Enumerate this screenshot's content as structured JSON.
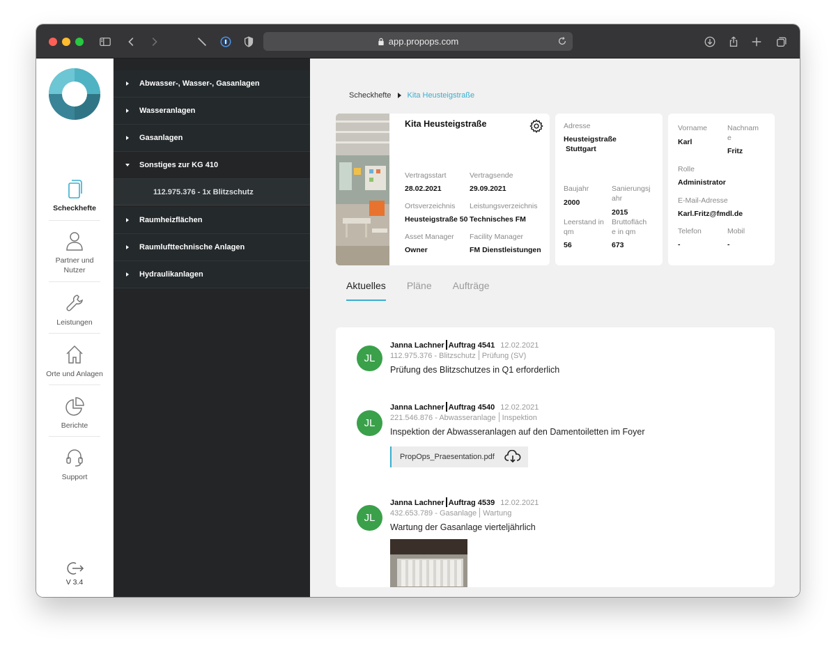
{
  "browser": {
    "url": "app.propops.com",
    "traffic_colors": [
      "#fe5f57",
      "#febc2e",
      "#28c840"
    ]
  },
  "sidebar": {
    "items": [
      {
        "label": "Scheckhefte",
        "icon": "copy-icon"
      },
      {
        "label": "Partner und Nutzer",
        "icon": "user-icon"
      },
      {
        "label": "Leistungen",
        "icon": "wrench-icon"
      },
      {
        "label": "Orte und Anlagen",
        "icon": "home-icon"
      },
      {
        "label": "Berichte",
        "icon": "pie-chart-icon"
      },
      {
        "label": "Support",
        "icon": "headset-icon"
      }
    ],
    "version": "V 3.4"
  },
  "tree": {
    "items": [
      {
        "label": "Abwasser-, Wasser-, Gasanlagen"
      },
      {
        "label": "Wasseranlagen"
      },
      {
        "label": "Gasanlagen"
      },
      {
        "label": "Sonstiges zur KG 410"
      },
      {
        "label": "Raumheizflächen"
      },
      {
        "label": "Raumlufttechnische Anlagen"
      },
      {
        "label": "Hydraulikanlagen"
      }
    ],
    "sub_item": "112.975.376 - 1x Blitzschutz"
  },
  "breadcrumb": {
    "root": "Scheckhefte",
    "current": "Kita Heusteigstraße"
  },
  "property": {
    "title": "Kita Heusteigstraße",
    "vertragsstart_label": "Vertragsstart",
    "vertragsstart": "28.02.2021",
    "vertragsende_label": "Vertragsende",
    "vertragsende": "29.09.2021",
    "orts_label": "Ortsverzeichnis",
    "orts": "Heusteigstraße 50",
    "leistungs_label": "Leistungsverzeichnis",
    "leistungs": "Technisches FM",
    "asset_label": "Asset Manager",
    "asset": "Owner",
    "facility_label": "Facility Manager",
    "facility": "FM Dienstleistungen"
  },
  "address": {
    "label": "Adresse",
    "street": "Heusteigstraße",
    "city": "Stuttgart",
    "baujahr_label": "Baujahr",
    "baujahr": "2000",
    "sanierung_label_1": "Sanierungsj",
    "sanierung_label_2": "ahr",
    "sanierung": "2015",
    "leerstand_label_1": "Leerstand in",
    "leerstand_label_2": "qm",
    "leerstand": "56",
    "brutto_label_1": "Bruttofläch",
    "brutto_label_2": "e in qm",
    "brutto": "673"
  },
  "contact": {
    "vorname_label": "Vorname",
    "vorname": "Karl",
    "nachname_label_1": "Nachnam",
    "nachname_label_2": "e",
    "nachname": "Fritz",
    "rolle_label": "Rolle",
    "rolle": "Administrator",
    "email_label": "E-Mail-Adresse",
    "email": "Karl.Fritz@fmdl.de",
    "telefon_label": "Telefon",
    "telefon": "-",
    "mobil_label": "Mobil",
    "mobil": "-"
  },
  "tabs": [
    "Aktuelles",
    "Pläne",
    "Aufträge"
  ],
  "feed": [
    {
      "initials": "JL",
      "author": "Janna Lachner",
      "order": "Auftrag 4541",
      "date": "12.02.2021",
      "ref": "112.975.376 - Blitzschutz",
      "type": "Prüfung (SV)",
      "text": "Prüfung des Blitzschutzes in Q1 erforderlich"
    },
    {
      "initials": "JL",
      "author": "Janna Lachner",
      "order": "Auftrag 4540",
      "date": "12.02.2021",
      "ref": "221.546.876 - Abwasseranlage",
      "type": "Inspektion",
      "text": "Inspektion der Abwasseranlagen auf den Damentoiletten im Foyer",
      "attachment": "PropOps_Praesentation.pdf"
    },
    {
      "initials": "JL",
      "author": "Janna Lachner",
      "order": "Auftrag 4539",
      "date": "12.02.2021",
      "ref": "432.653.789 - Gasanlage",
      "type": "Wartung",
      "text": "Wartung der Gasanlage vierteljährlich"
    }
  ],
  "colors": {
    "accent": "#3aaecf",
    "avatar": "#3aa04a",
    "tree_bg": "#232527"
  }
}
